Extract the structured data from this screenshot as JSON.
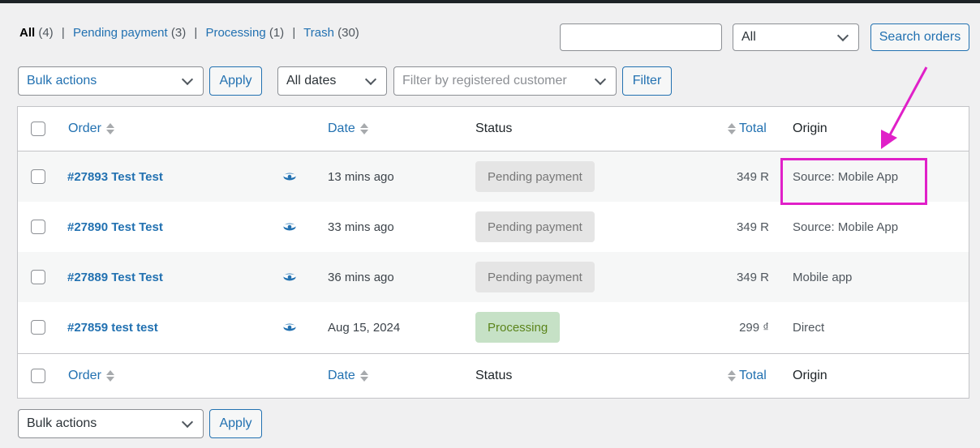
{
  "views": [
    {
      "label": "All",
      "count": "(4)"
    },
    {
      "label": "Pending payment",
      "count": "(3)"
    },
    {
      "label": "Processing",
      "count": "(1)"
    },
    {
      "label": "Trash",
      "count": "(30)"
    }
  ],
  "separator": "|",
  "search": {
    "value": "",
    "placeholder": "",
    "type_value": "All",
    "button": "Search orders"
  },
  "toolbar": {
    "bulk_actions": "Bulk actions",
    "apply": "Apply",
    "dates": "All dates",
    "customer_placeholder": "Filter by registered customer",
    "filter": "Filter"
  },
  "columns": {
    "order": "Order",
    "date": "Date",
    "status": "Status",
    "total": "Total",
    "origin": "Origin"
  },
  "orders": [
    {
      "title": "#27893 Test Test",
      "date": "13 mins ago",
      "status": "Pending payment",
      "status_type": "pending",
      "total": "349 R",
      "origin": "Source: Mobile App"
    },
    {
      "title": "#27890 Test Test",
      "date": "33 mins ago",
      "status": "Pending payment",
      "status_type": "pending",
      "total": "349 R",
      "origin": "Source: Mobile App"
    },
    {
      "title": "#27889 Test Test",
      "date": "36 mins ago",
      "status": "Pending payment",
      "status_type": "pending",
      "total": "349 R",
      "origin": "Mobile app"
    },
    {
      "title": "#27859 test test",
      "date": "Aug 15, 2024",
      "status": "Processing",
      "status_type": "processing",
      "total": "299 ₫",
      "origin": "Direct"
    }
  ],
  "bottom_toolbar": {
    "bulk_actions": "Bulk actions",
    "apply": "Apply"
  },
  "colors": {
    "link": "#2271b1",
    "annotation": "#e020c8",
    "pending_bg": "#e5e5e5",
    "processing_bg": "#c6e1c6"
  },
  "icons": {
    "view": "eye-icon",
    "sort": "sort-arrows-icon",
    "dropdown": "chevron-down-icon"
  }
}
